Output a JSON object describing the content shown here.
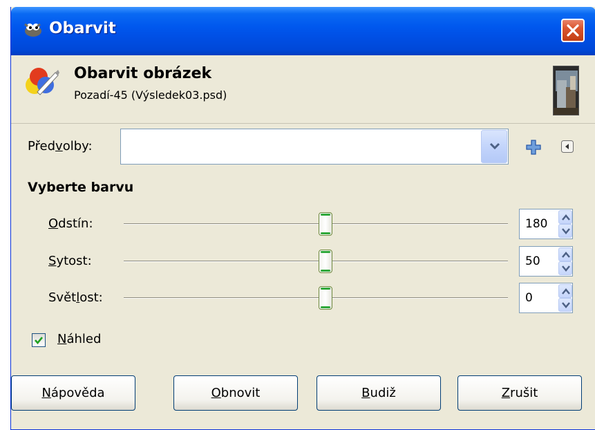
{
  "window": {
    "title": "Obarvit",
    "logo_icon": "gimp-logo-icon",
    "close_icon": "close-icon"
  },
  "header": {
    "title": "Obarvit obrázek",
    "subtitle": "Pozadí-45 (Výsledek03.psd)",
    "icon": "colorize-icon",
    "thumbnail": "image-thumbnail"
  },
  "presets": {
    "label_pre": "Před",
    "label_mnemonic": "v",
    "label_post": "olby:",
    "value": "",
    "add_icon": "plus-icon",
    "menu_icon": "triangle-left-icon"
  },
  "section": {
    "label": "Vyberte barvu"
  },
  "sliders": [
    {
      "label_pre": "",
      "label_mnemonic": "O",
      "label_post": "dstín:",
      "value": "180",
      "fraction": 0.5
    },
    {
      "label_pre": "",
      "label_mnemonic": "S",
      "label_post": "ytost:",
      "value": "50",
      "fraction": 0.5
    },
    {
      "label_pre": "Svět",
      "label_mnemonic": "l",
      "label_post": "ost:",
      "value": "0",
      "fraction": 0.5
    }
  ],
  "preview": {
    "label_pre": "",
    "label_mnemonic": "N",
    "label_post": "áhled",
    "checked": true
  },
  "buttons": [
    {
      "mnemonic": "N",
      "rest": "ápověda"
    },
    {
      "mnemonic": "O",
      "rest": "bnovit"
    },
    {
      "mnemonic": "B",
      "rest": "udiž"
    },
    {
      "mnemonic": "Z",
      "rest": "rušit"
    }
  ],
  "colors": {
    "titlebar": "#0058ee",
    "dialog_bg": "#ece9d8",
    "close": "#d9542e",
    "slider_accent": "#2fa83a"
  }
}
